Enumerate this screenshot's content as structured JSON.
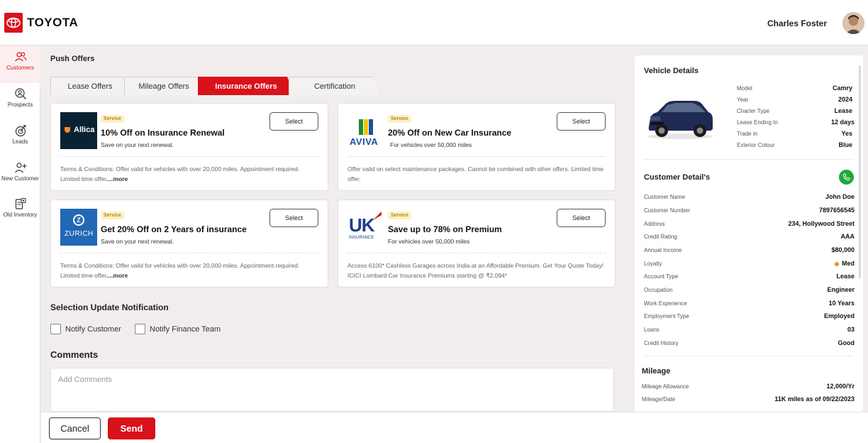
{
  "header": {
    "brand": "TOYOTA",
    "username": "Charles Foster"
  },
  "sidebar": {
    "items": [
      {
        "label": "Customers",
        "icon": "users-icon",
        "active": true
      },
      {
        "label": "Prospects",
        "icon": "search-person-icon"
      },
      {
        "label": "Leads",
        "icon": "leads-icon"
      },
      {
        "label": "New Customer",
        "icon": "add-user-icon"
      },
      {
        "label": "Old Inventory",
        "icon": "inventory-icon"
      }
    ]
  },
  "main": {
    "title": "Push Offers",
    "tabs": [
      {
        "label": "Lease Offers"
      },
      {
        "label": "Mileage Offers"
      },
      {
        "label": "Insurance Offers",
        "active": true
      },
      {
        "label": "Certification"
      }
    ],
    "offers": [
      {
        "logo_text": "Allica",
        "badge": "Service",
        "title": "10% Off on Insurance Renewal",
        "subtitle": "Save on your next renewal.",
        "select_label": "Select",
        "terms": "Terms & Conditions: Offer valid for vehicles with over 20,000 miles. Appointment required. Limited time offer",
        "more": "....more"
      },
      {
        "logo_text": "AVIVA",
        "badge": "Service",
        "title": "20% Off  on New Car Insurance",
        "subtitle": "For vehicles over 50,000 miles",
        "select_label": "Select",
        "terms": "Offer valid on select maintenance packages. Cannot be combined with other offers. Limited time offer.",
        "more": ""
      },
      {
        "logo_text": "ZURICH",
        "badge": "Service",
        "title": "Get 20% Off on 2 Years of  insurance",
        "subtitle": "Save on your next renewal.",
        "select_label": "Select",
        "terms": "Terms & Conditions: Offer valid for vehicles with over 20,000 miles. Appointment required. Limited time offer",
        "more": "....more"
      },
      {
        "logo_text": "UK",
        "logo_sub": "INSURANCE",
        "badge": "Service",
        "title": "Save up to 78% on Premium",
        "subtitle": "For vehicles over 50,000 miles",
        "select_label": "Select",
        "terms": "Access 6100* Cashless Garages across India at an Affordable Premium. Get Your Quote Today! ICICI Lombard Car Insurance Premiums starting @ ₹2,094*",
        "more": ""
      }
    ],
    "notification": {
      "title": "Selection Update Notification",
      "options": [
        "Notify Customer",
        "Notify Finance Team"
      ]
    },
    "comments": {
      "title": "Comments",
      "placeholder": "Add Comments"
    }
  },
  "footer": {
    "cancel_label": "Cancel",
    "send_label": "Send"
  },
  "vehicle": {
    "title": "Vehicle Details",
    "fields": [
      {
        "label": "Model",
        "value": "Camry"
      },
      {
        "label": "Year",
        "value": "2024"
      },
      {
        "label": "Charter Type",
        "value": "Lease"
      },
      {
        "label": "Lease Ending In",
        "value": "12 days"
      },
      {
        "label": "Trade in",
        "value": "Yes"
      },
      {
        "label": "Exterior Colour",
        "value": "Blue"
      }
    ]
  },
  "customer": {
    "title": "Customer Detail's",
    "fields": [
      {
        "label": "Customer Name",
        "value": "John Doe"
      },
      {
        "label": "Customer Number",
        "value": "7897656545"
      },
      {
        "label": "Address",
        "value": "234, Hollywood Street"
      },
      {
        "label": "Credit Rating",
        "value": "AAA"
      },
      {
        "label": "Annual Income",
        "value": "$80,000"
      },
      {
        "label": "Loyalty",
        "value": "Med"
      },
      {
        "label": "Account Type",
        "value": "Lease"
      },
      {
        "label": "Occupation",
        "value": "Engineer"
      },
      {
        "label": "Work Experience",
        "value": "10 Years"
      },
      {
        "label": "Employment Type",
        "value": "Employed"
      },
      {
        "label": "Loans",
        "value": "03"
      },
      {
        "label": "Credit History",
        "value": "Good"
      }
    ]
  },
  "mileage": {
    "title": "Mileage",
    "fields": [
      {
        "label": "Mileage Allowance",
        "value": "12,000/Yr"
      },
      {
        "label": "Mileage/Date",
        "value": "11K miles  as of 09/22/2023"
      }
    ]
  },
  "colors": {
    "brand_red": "#d9111a",
    "badge_bg": "#fdf0c8",
    "call_green": "#1ea83c",
    "loyalty_dot": "#f28c28"
  }
}
